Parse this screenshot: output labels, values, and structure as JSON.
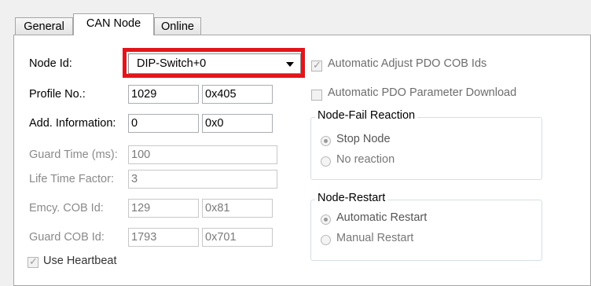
{
  "tabs": [
    {
      "label": "General",
      "active": false
    },
    {
      "label": "CAN Node",
      "active": true
    },
    {
      "label": "Online",
      "active": false
    }
  ],
  "node_id": {
    "label": "Node Id:",
    "value": "DIP-Switch+0"
  },
  "profile": {
    "label": "Profile No.:",
    "dec": "1029",
    "hex": "0x405"
  },
  "add_info": {
    "label": "Add. Information:",
    "dec": "0",
    "hex": "0x0"
  },
  "guard_time": {
    "label": "Guard Time (ms):",
    "value": "100"
  },
  "life_time": {
    "label": "Life Time Factor:",
    "value": "3"
  },
  "emcy": {
    "label": "Emcy. COB Id:",
    "dec": "129",
    "hex": "0x81"
  },
  "guard_cob": {
    "label": "Guard COB Id:",
    "dec": "1793",
    "hex": "0x701"
  },
  "heartbeat": {
    "label": "Use Heartbeat",
    "checked": true
  },
  "auto_adjust": {
    "label": "Automatic Adjust PDO COB Ids",
    "checked": true
  },
  "auto_pdo": {
    "label": "Automatic PDO Parameter Download",
    "checked": false
  },
  "node_fail": {
    "title": "Node-Fail Reaction",
    "options": [
      {
        "label": "Stop Node",
        "selected": true
      },
      {
        "label": "No reaction",
        "selected": false
      }
    ]
  },
  "node_restart": {
    "title": "Node-Restart",
    "options": [
      {
        "label": "Automatic Restart",
        "selected": true
      },
      {
        "label": "Manual Restart",
        "selected": false
      }
    ]
  }
}
